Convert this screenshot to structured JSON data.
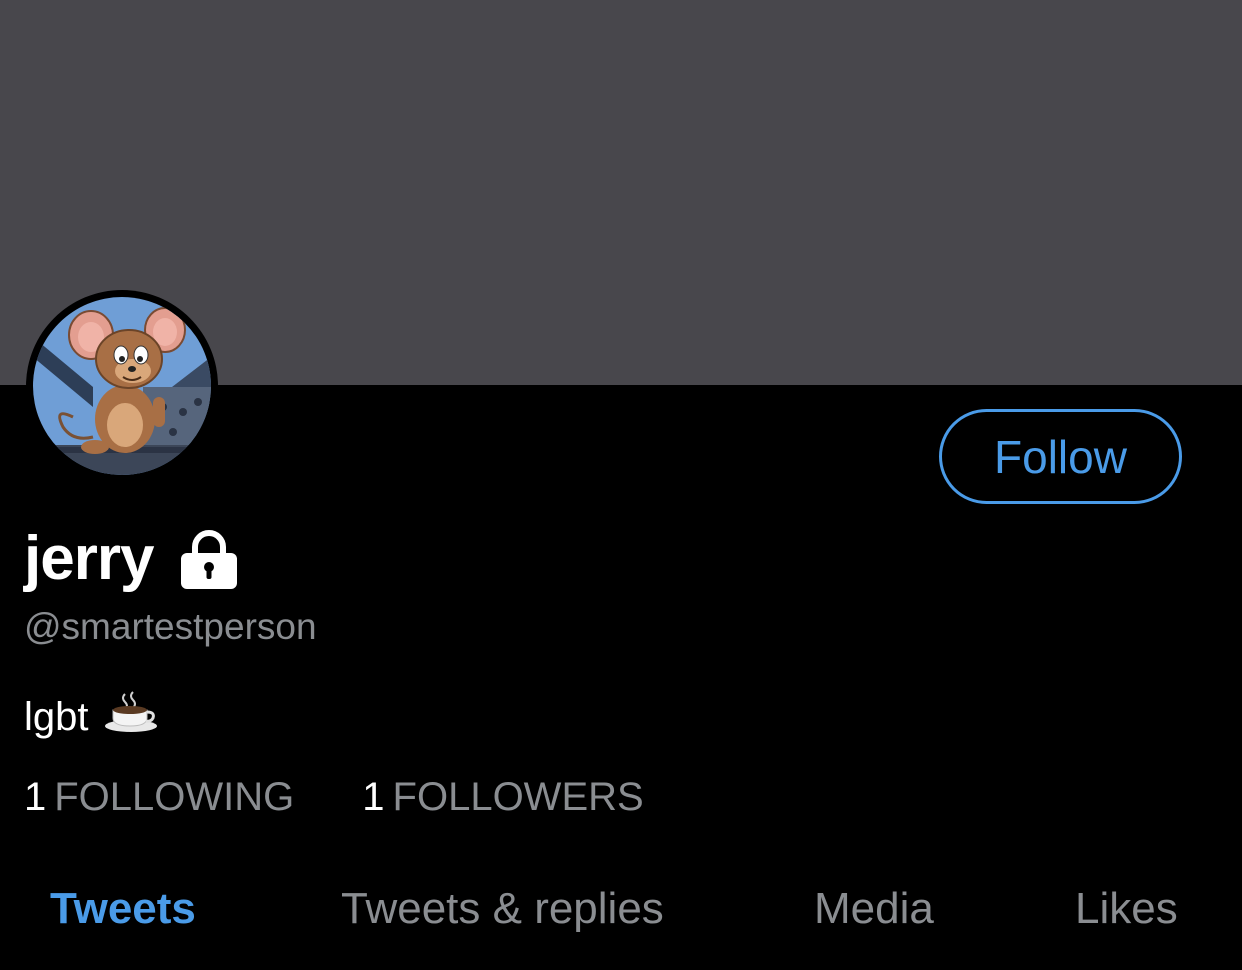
{
  "profile": {
    "display_name": "jerry",
    "locked_icon": "lock-icon",
    "handle": "@smartestperson",
    "bio": "lgbt",
    "bio_emoji": "coffee-cup-icon",
    "avatar": "avatar-jerry-mouse"
  },
  "actions": {
    "follow_label": "Follow"
  },
  "stats": {
    "following_count": "1",
    "following_label": "FOLLOWING",
    "followers_count": "1",
    "followers_label": "FOLLOWERS"
  },
  "tabs": [
    {
      "label": "Tweets",
      "active": true
    },
    {
      "label": "Tweets & replies",
      "active": false
    },
    {
      "label": "Media",
      "active": false
    },
    {
      "label": "Likes",
      "active": false
    }
  ],
  "colors": {
    "banner": "#48474c",
    "background": "#000000",
    "accent": "#4a9be8",
    "muted_text": "#8a8d91"
  }
}
